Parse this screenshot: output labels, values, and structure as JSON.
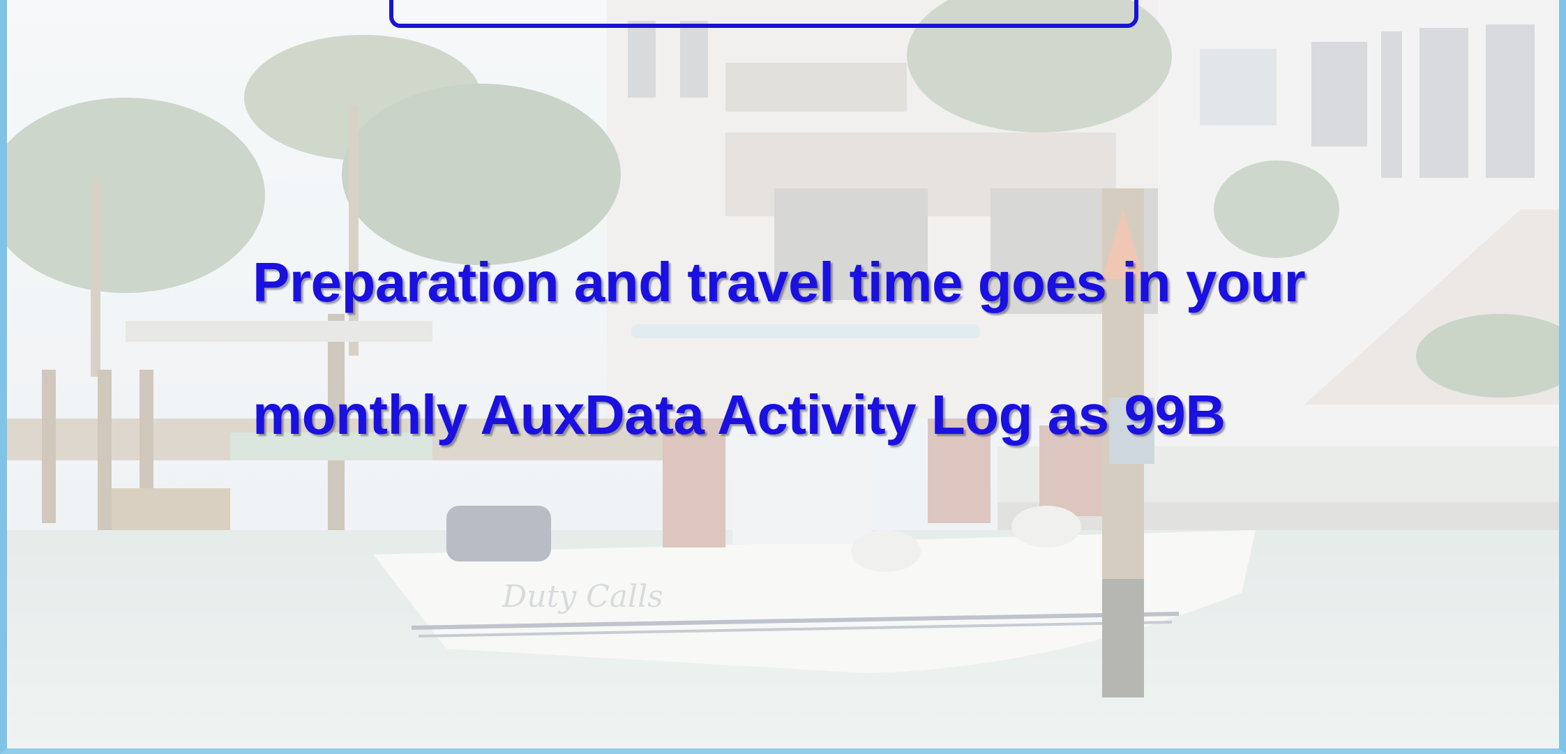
{
  "slide": {
    "lines": [
      "Preparation and travel time goes in your",
      "monthly AuxData Activity Log as 99B"
    ],
    "title": ""
  },
  "background": {
    "description_icon": "boat-dock-photo-icon"
  },
  "colors": {
    "text": "#1a10e0",
    "frame": "#7fc3e6",
    "title_border": "#1a12d6"
  }
}
